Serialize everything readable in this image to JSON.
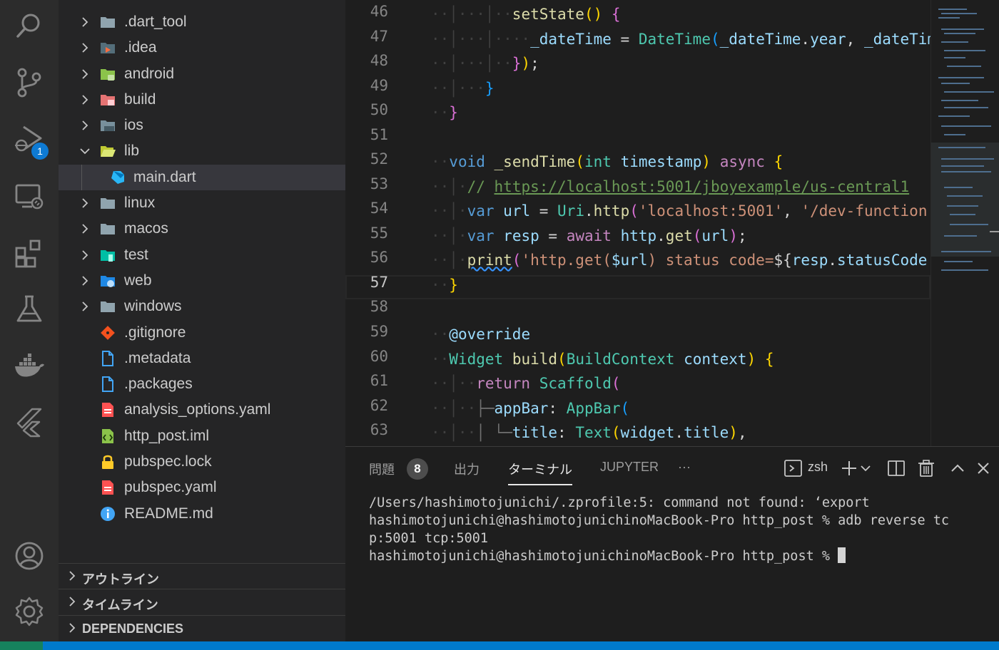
{
  "colors": {
    "activity_bar": "#2c2c2c",
    "sidebar": "#252526",
    "editor": "#1e1e1e",
    "status_bar": "#007acc",
    "badge": "#0e7ad3"
  },
  "activity_bar": {
    "items": [
      {
        "name": "search-icon"
      },
      {
        "name": "source-control-icon"
      },
      {
        "name": "run-debug-icon",
        "badge": "1"
      },
      {
        "name": "remote-explorer-icon"
      },
      {
        "name": "extensions-icon"
      },
      {
        "name": "testing-icon"
      },
      {
        "name": "docker-icon"
      },
      {
        "name": "flutter-icon"
      },
      {
        "name": "account-icon"
      },
      {
        "name": "settings-gear-icon"
      }
    ]
  },
  "explorer": {
    "items": [
      {
        "label": ".dart_tool",
        "type": "folder",
        "expanded": false,
        "icon": "folder-icon"
      },
      {
        "label": ".idea",
        "type": "folder",
        "expanded": false,
        "icon": "idea-folder-icon"
      },
      {
        "label": "android",
        "type": "folder",
        "expanded": false,
        "icon": "android-folder-icon"
      },
      {
        "label": "build",
        "type": "folder",
        "expanded": false,
        "icon": "build-folder-icon"
      },
      {
        "label": "ios",
        "type": "folder",
        "expanded": false,
        "icon": "ios-folder-icon"
      },
      {
        "label": "lib",
        "type": "folder",
        "expanded": true,
        "icon": "lib-folder-open-icon"
      },
      {
        "label": "main.dart",
        "type": "file",
        "selected": true,
        "icon": "dart-file-icon"
      },
      {
        "label": "linux",
        "type": "folder",
        "expanded": false,
        "icon": "folder-icon"
      },
      {
        "label": "macos",
        "type": "folder",
        "expanded": false,
        "icon": "folder-icon"
      },
      {
        "label": "test",
        "type": "folder",
        "expanded": false,
        "icon": "test-folder-icon"
      },
      {
        "label": "web",
        "type": "folder",
        "expanded": false,
        "icon": "web-folder-icon"
      },
      {
        "label": "windows",
        "type": "folder",
        "expanded": false,
        "icon": "folder-icon"
      },
      {
        "label": ".gitignore",
        "type": "file",
        "icon": "git-file-icon"
      },
      {
        "label": ".metadata",
        "type": "file",
        "icon": "file-icon"
      },
      {
        "label": ".packages",
        "type": "file",
        "icon": "file-icon"
      },
      {
        "label": "analysis_options.yaml",
        "type": "file",
        "icon": "yaml-file-icon"
      },
      {
        "label": "http_post.iml",
        "type": "file",
        "icon": "iml-file-icon"
      },
      {
        "label": "pubspec.lock",
        "type": "file",
        "icon": "lock-file-icon"
      },
      {
        "label": "pubspec.yaml",
        "type": "file",
        "icon": "yaml-file-icon"
      },
      {
        "label": "README.md",
        "type": "file",
        "icon": "info-file-icon"
      }
    ],
    "sections": [
      {
        "label": "アウトライン"
      },
      {
        "label": "タイムライン"
      },
      {
        "label": "DEPENDENCIES"
      }
    ]
  },
  "editor": {
    "active_line": "57",
    "line_numbers": [
      "46",
      "47",
      "48",
      "49",
      "50",
      "51",
      "52",
      "53",
      "54",
      "55",
      "56",
      "57",
      "58",
      "59",
      "60",
      "61",
      "62",
      "63"
    ]
  },
  "panel": {
    "tabs": [
      {
        "label": "問題",
        "badge": "8"
      },
      {
        "label": "出力"
      },
      {
        "label": "ターミナル",
        "active": true
      },
      {
        "label": "JUPYTER"
      },
      {
        "label": "···"
      }
    ],
    "shell": "zsh",
    "terminal_lines": [
      "/Users/hashimotojunichi/.zprofile:5: command not found: ‘export",
      "hashimotojunichi@hashimotojunichinoMacBook-Pro http_post % adb reverse tc",
      "p:5001 tcp:5001",
      "hashimotojunichi@hashimotojunichinoMacBook-Pro http_post % "
    ]
  }
}
